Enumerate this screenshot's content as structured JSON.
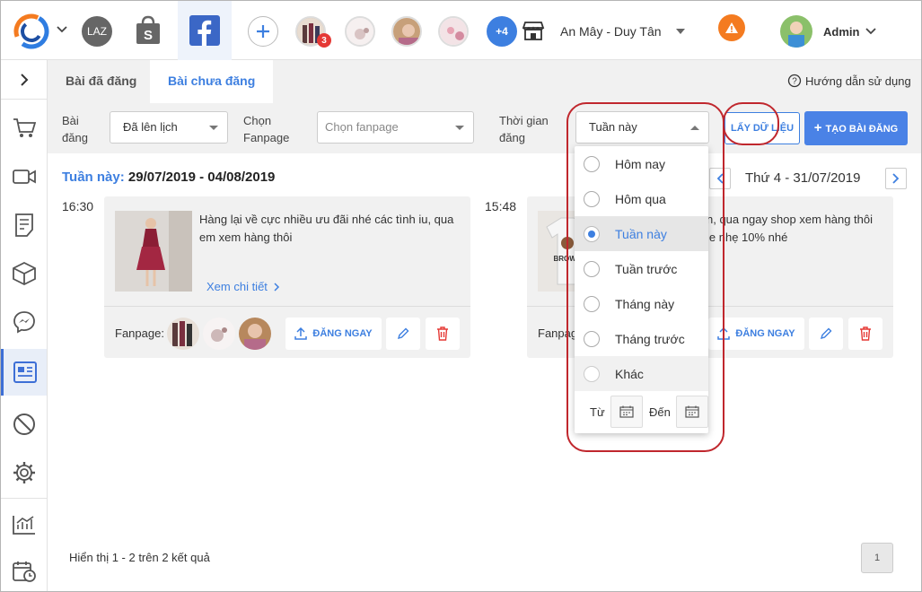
{
  "topbar": {
    "store_name": "An Mây - Duy Tân",
    "user_name": "Admin",
    "extra_pages_badge": "+4",
    "notification_count": "3",
    "lazada_label": "LAZ"
  },
  "tabs": [
    {
      "label": "Bài đã đăng",
      "active": false
    },
    {
      "label": "Bài chưa đăng",
      "active": true
    }
  ],
  "help_link": "Hướng dẫn sử dụng",
  "filters": {
    "status_label_1": "Bài",
    "status_label_2": "đăng",
    "status_value": "Đã lên lịch",
    "fanpage_label_1": "Chọn",
    "fanpage_label_2": "Fanpage",
    "fanpage_placeholder": "Chọn fanpage",
    "time_label_1": "Thời gian",
    "time_label_2": "đăng",
    "time_value": "Tuần này",
    "fetch_button": "LẤY DỮ LIỆU",
    "create_button": "TẠO BÀI ĐĂNG"
  },
  "week": {
    "prefix": "Tuần này:",
    "range": "29/07/2019 - 04/08/2019",
    "day_label": "Thứ 4 - 31/07/2019"
  },
  "posts": [
    {
      "time": "16:30",
      "text_line1": "Hàng lại về cực nhiều ưu đãi nhé các tình iu, qua",
      "text_line2": "em xem hàng thôi",
      "detail_link": "Xem chi tiết",
      "fanpage_label": "Fanpage:",
      "post_now": "ĐĂNG NGAY"
    },
    {
      "time": "15:48",
      "text_line1": "n, qua ngay shop xem hàng thôi",
      "text_line2": "le nhẹ 10% nhé",
      "fanpage_label": "Fanpag",
      "post_now": "ĐĂNG NGAY",
      "shirt_text": "BROWN"
    }
  ],
  "dropdown": {
    "options": [
      {
        "label": "Hôm nay",
        "selected": false
      },
      {
        "label": "Hôm qua",
        "selected": false
      },
      {
        "label": "Tuần này",
        "selected": true
      },
      {
        "label": "Tuần trước",
        "selected": false
      },
      {
        "label": "Tháng này",
        "selected": false
      },
      {
        "label": "Tháng trước",
        "selected": false
      },
      {
        "label": "Khác",
        "selected": false
      }
    ],
    "from_label": "Từ",
    "to_label": "Đến"
  },
  "footer": {
    "summary": "Hiển thị 1 - 2 trên 2 kết quả",
    "page": "1"
  },
  "colors": {
    "accent": "#3d7fe0",
    "annotation": "#c0272d",
    "warning": "#f47b20",
    "danger": "#e53935"
  }
}
